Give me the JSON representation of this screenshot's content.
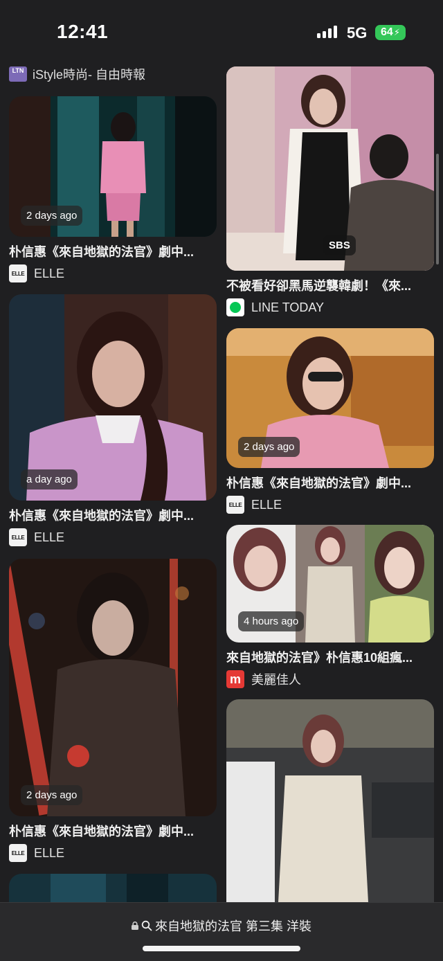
{
  "status_bar": {
    "time": "12:41",
    "network": "5G",
    "battery": "64"
  },
  "source_header": {
    "logo_text": "LTN",
    "name": "iStyle時尚- 自由時報"
  },
  "results": {
    "left": [
      {
        "time": "2 days ago",
        "title": "朴信惠《來自地獄的法官》劇中...",
        "source": "ELLE"
      },
      {
        "time": "a day ago",
        "title": "朴信惠《來自地獄的法官》劇中...",
        "source": "ELLE"
      },
      {
        "time": "2 days ago",
        "title": "朴信惠《來自地獄的法官》劇中...",
        "source": "ELLE"
      }
    ],
    "right": [
      {
        "title": "不被看好卻黑馬逆襲韓劇！《來...",
        "source": "LINE TODAY",
        "caption": "SBS"
      },
      {
        "time": "2 days ago",
        "title": "朴信惠《來自地獄的法官》劇中...",
        "source": "ELLE"
      },
      {
        "time": "4 hours ago",
        "title": "來自地獄的法官》朴信惠10組瘋...",
        "source": "美麗佳人"
      }
    ]
  },
  "address_bar": {
    "url": "來自地獄的法官 第三集 洋裝"
  },
  "icons": [
    "signal-icon",
    "lock-icon",
    "search-icon",
    "line-logo-icon"
  ]
}
